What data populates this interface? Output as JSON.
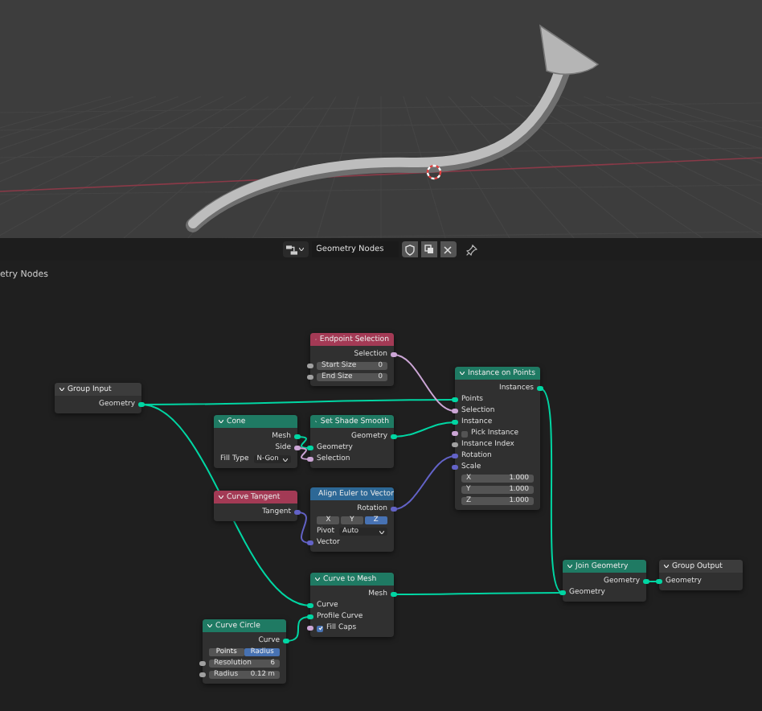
{
  "header": {
    "tree_name": "Geometry Nodes"
  },
  "breadcrumb": "etry Nodes",
  "nodes": [
    {
      "title": "Group Input",
      "color": "#3c3c3c",
      "rows": [
        {
          "kind": "output",
          "label": "Geometry",
          "color": "#00d6a3"
        }
      ]
    },
    {
      "title": "Endpoint Selection",
      "color": "#a33a55",
      "rows": [
        {
          "kind": "output",
          "label": "Selection",
          "color": "#cca6d6"
        },
        {
          "kind": "field",
          "label": "Start Size",
          "value": "0",
          "color": "#a1a1a1"
        },
        {
          "kind": "field",
          "label": "End Size",
          "value": "0",
          "color": "#a1a1a1"
        }
      ]
    },
    {
      "title": "Cone",
      "color": "#1f7a63",
      "rows": [
        {
          "kind": "output",
          "label": "Mesh",
          "color": "#00d6a3"
        },
        {
          "kind": "output",
          "label": "Side",
          "color": "#cca6d6"
        },
        {
          "kind": "dropdown",
          "label": "Fill Type",
          "value": "N-Gon"
        }
      ]
    },
    {
      "title": "Set Shade Smooth",
      "color": "#1f7a63",
      "rows": [
        {
          "kind": "output",
          "label": "Geometry",
          "color": "#00d6a3"
        },
        {
          "kind": "input",
          "label": "Geometry",
          "color": "#00d6a3"
        },
        {
          "kind": "input",
          "label": "Selection",
          "color": "#cca6d6"
        }
      ]
    },
    {
      "title": "Curve Tangent",
      "color": "#a33a55",
      "rows": [
        {
          "kind": "output",
          "label": "Tangent",
          "color": "#6363c7"
        }
      ]
    },
    {
      "title": "Align Euler to Vector",
      "color": "#2d6896",
      "rows": [
        {
          "kind": "output",
          "label": "Rotation",
          "color": "#6363c7"
        },
        {
          "kind": "enum",
          "options": [
            {
              "label": "X",
              "selected": false
            },
            {
              "label": "Y",
              "selected": false
            },
            {
              "label": "Z",
              "selected": true
            }
          ]
        },
        {
          "kind": "dropdown",
          "label": "Pivot",
          "value": "Auto"
        },
        {
          "kind": "input",
          "label": "Vector",
          "color": "#6363c7"
        }
      ]
    },
    {
      "title": "Curve to Mesh",
      "color": "#1f7a63",
      "rows": [
        {
          "kind": "output",
          "label": "Mesh",
          "color": "#00d6a3"
        },
        {
          "kind": "input",
          "label": "Curve",
          "color": "#00d6a3"
        },
        {
          "kind": "input",
          "label": "Profile Curve",
          "color": "#00d6a3"
        },
        {
          "kind": "checkbox",
          "label": "Fill Caps",
          "checked": true,
          "color": "#cca6d6"
        }
      ]
    },
    {
      "title": "Curve Circle",
      "color": "#1f7a63",
      "rows": [
        {
          "kind": "output",
          "label": "Curve",
          "color": "#00d6a3"
        },
        {
          "kind": "enum",
          "options": [
            {
              "label": "Points",
              "selected": false
            },
            {
              "label": "Radius",
              "selected": true
            }
          ]
        },
        {
          "kind": "field",
          "label": "Resolution",
          "value": "6",
          "color": "#a1a1a1"
        },
        {
          "kind": "field",
          "label": "Radius",
          "value": "0.12 m",
          "color": "#a1a1a1"
        }
      ]
    },
    {
      "title": "Instance on Points",
      "color": "#1f7a63",
      "rows": [
        {
          "kind": "output",
          "label": "Instances",
          "color": "#00d6a3"
        },
        {
          "kind": "input",
          "label": "Points",
          "color": "#00d6a3"
        },
        {
          "kind": "input",
          "label": "Selection",
          "color": "#cca6d6"
        },
        {
          "kind": "input",
          "label": "Instance",
          "color": "#00d6a3"
        },
        {
          "kind": "checkbox",
          "label": "Pick Instance",
          "checked": false,
          "color": "#cca6d6"
        },
        {
          "kind": "input",
          "label": "Instance Index",
          "color": "#a1a1a1"
        },
        {
          "kind": "input",
          "label": "Rotation",
          "color": "#6363c7"
        },
        {
          "kind": "input",
          "label": "Scale",
          "color": "#6363c7"
        },
        {
          "kind": "field",
          "label": "X",
          "value": "1.000"
        },
        {
          "kind": "field",
          "label": "Y",
          "value": "1.000"
        },
        {
          "kind": "field",
          "label": "Z",
          "value": "1.000"
        }
      ]
    },
    {
      "title": "Join Geometry",
      "color": "#1f7a63",
      "rows": [
        {
          "kind": "output",
          "label": "Geometry",
          "color": "#00d6a3"
        },
        {
          "kind": "input",
          "label": "Geometry",
          "color": "#00d6a3"
        }
      ]
    },
    {
      "title": "Group Output",
      "color": "#3c3c3c",
      "rows": [
        {
          "kind": "input",
          "label": "Geometry",
          "color": "#00d6a3"
        }
      ]
    }
  ]
}
